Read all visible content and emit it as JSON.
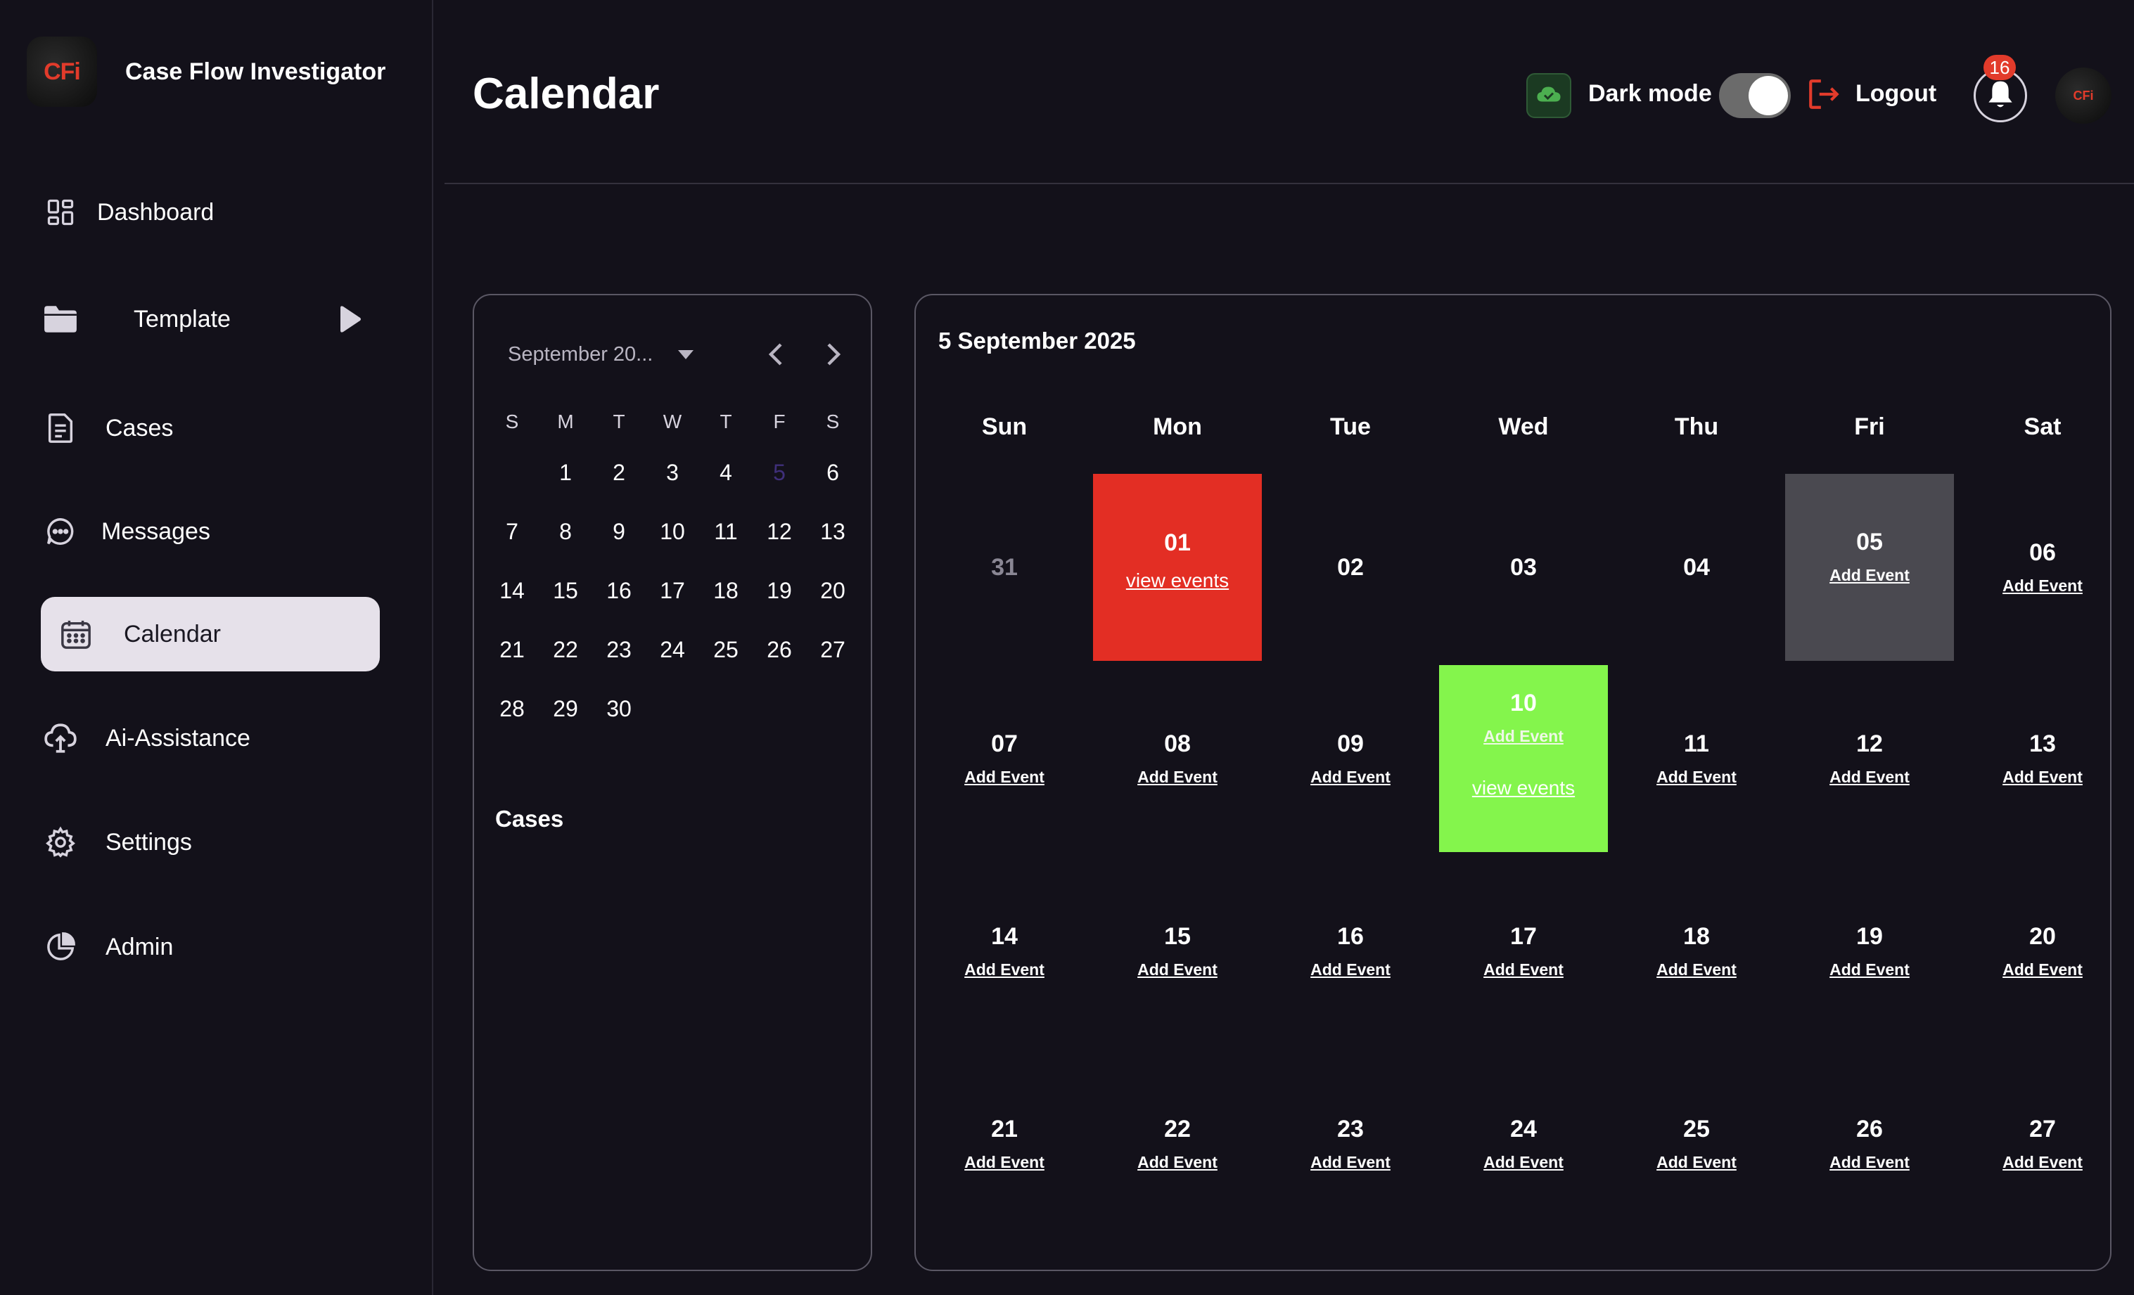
{
  "app": {
    "title": "Case Flow Investigator",
    "logo_text": "CFi"
  },
  "sidebar": {
    "items": [
      {
        "label": "Dashboard",
        "icon": "dashboard-icon"
      },
      {
        "label": "Template",
        "icon": "folder-icon"
      },
      {
        "label": "Cases",
        "icon": "document-icon"
      },
      {
        "label": "Messages",
        "icon": "chat-icon"
      },
      {
        "label": "Calendar",
        "icon": "calendar-icon",
        "active": true
      },
      {
        "label": "Ai-Assistance",
        "icon": "cloud-brain-icon"
      },
      {
        "label": "Settings",
        "icon": "gear-icon"
      },
      {
        "label": "Admin",
        "icon": "pie-chart-icon"
      }
    ]
  },
  "header": {
    "title": "Calendar",
    "dark_mode_label": "Dark mode",
    "dark_mode_on": true,
    "logout_label": "Logout",
    "notification_count": "16",
    "avatar_text": "CFi"
  },
  "mini_calendar": {
    "month_label": "September 20...",
    "weekday_heads": [
      "S",
      "M",
      "T",
      "W",
      "T",
      "F",
      "S"
    ],
    "weeks": [
      [
        "",
        "1",
        "2",
        "3",
        "4",
        "5",
        "6"
      ],
      [
        "7",
        "8",
        "9",
        "10",
        "11",
        "12",
        "13"
      ],
      [
        "14",
        "15",
        "16",
        "17",
        "18",
        "19",
        "20"
      ],
      [
        "21",
        "22",
        "23",
        "24",
        "25",
        "26",
        "27"
      ],
      [
        "28",
        "29",
        "30",
        "",
        "",
        "",
        ""
      ]
    ],
    "today": "5",
    "cases_label": "Cases"
  },
  "main_calendar": {
    "selected_date": "5 September 2025",
    "weekday_heads": [
      "Sun",
      "Mon",
      "Tue",
      "Wed",
      "Thu",
      "Fri",
      "Sat"
    ],
    "add_event_label": "Add Event",
    "view_events_label": "view events",
    "weeks": [
      [
        {
          "day": "31",
          "muted": true,
          "add": false
        },
        {
          "day": "01",
          "style": "red",
          "add": false,
          "view": true
        },
        {
          "day": "02",
          "add": false
        },
        {
          "day": "03",
          "add": false
        },
        {
          "day": "04",
          "add": false
        },
        {
          "day": "05",
          "style": "grey",
          "add": true
        },
        {
          "day": "06",
          "add": true
        }
      ],
      [
        {
          "day": "07",
          "add": true
        },
        {
          "day": "08",
          "add": true
        },
        {
          "day": "09",
          "add": true
        },
        {
          "day": "10",
          "style": "green",
          "add": true,
          "view": true
        },
        {
          "day": "11",
          "add": true
        },
        {
          "day": "12",
          "add": true
        },
        {
          "day": "13",
          "add": true
        }
      ],
      [
        {
          "day": "14",
          "add": true
        },
        {
          "day": "15",
          "add": true
        },
        {
          "day": "16",
          "add": true
        },
        {
          "day": "17",
          "add": true
        },
        {
          "day": "18",
          "add": true
        },
        {
          "day": "19",
          "add": true
        },
        {
          "day": "20",
          "add": true
        }
      ],
      [
        {
          "day": "21",
          "add": true
        },
        {
          "day": "22",
          "add": true
        },
        {
          "day": "23",
          "add": true
        },
        {
          "day": "24",
          "add": true
        },
        {
          "day": "25",
          "add": true
        },
        {
          "day": "26",
          "add": true
        },
        {
          "day": "27",
          "add": true
        }
      ]
    ]
  },
  "colors": {
    "background": "#13111a",
    "accent_red": "#e32e24",
    "event_green": "#84f54c",
    "selected_grey": "#4a4950",
    "active_nav": "#e6e1ea"
  }
}
